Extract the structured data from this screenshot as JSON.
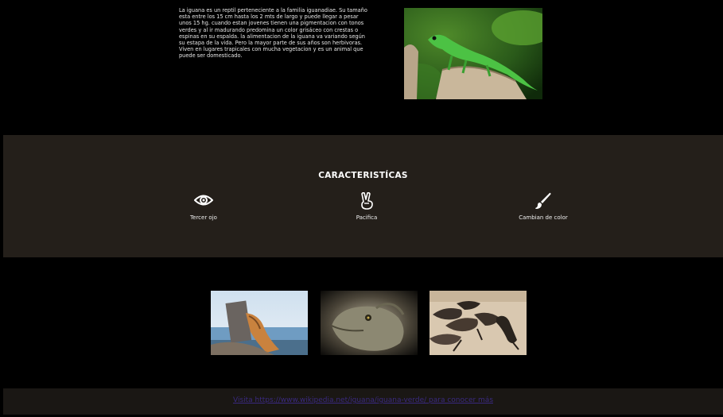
{
  "intro": {
    "text": "La iguana es un reptil perteneciente a la familia iguanadiae. Su tamaño esta entre los 15 cm hasta los 2 mts de largo y puede llegar a pesar unos 15 hg. cuando estan jovenes tienen una pigmentacion con tonos verdes y al ir madurando predomina un color grisáceo con crestas o espinas en su espalda. la alimentacion de la iguana va variando según su estapa de la vida. Pero la mayor parte de sus años son herbivoras. Viven en lugares trapicales con mucha vegetacion y es un animal que puede ser domesticado."
  },
  "features": {
    "title": "CARACTERISTÍCAS",
    "items": [
      {
        "icon": "eye-icon",
        "label": "Tercer ojo"
      },
      {
        "icon": "peace-hand-icon",
        "label": "Pacifica"
      },
      {
        "icon": "paint-brush-icon",
        "label": "Cambian de color"
      }
    ]
  },
  "footer": {
    "link": "Visita https://www.wikipedia.net/iguana/iguana-verde/ para conocer más"
  },
  "colors": {
    "background": "#000000",
    "features_band": "#241f1a",
    "footer_band": "#1a1714",
    "link": "#3a2a80"
  }
}
